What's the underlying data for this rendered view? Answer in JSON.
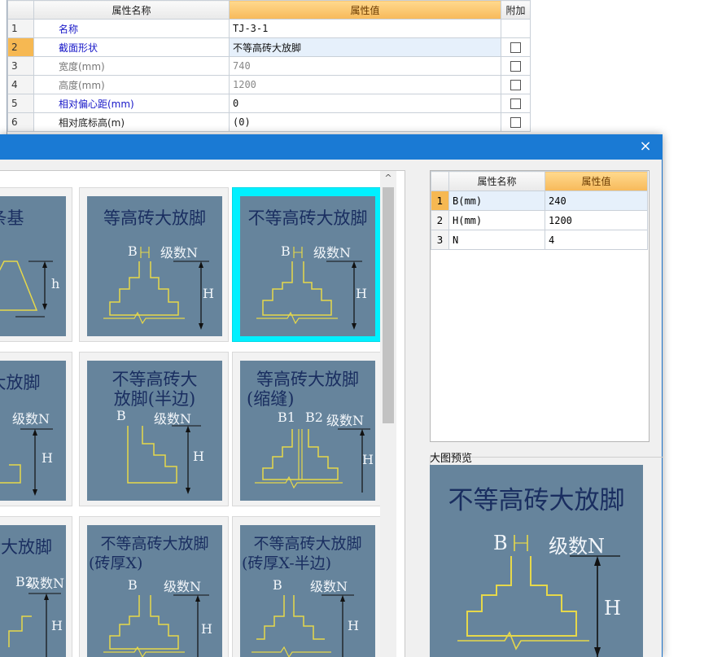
{
  "property_grid": {
    "headers": {
      "index": "",
      "name": "属性名称",
      "value": "属性值",
      "extra": "附加"
    },
    "rows": [
      {
        "num": "1",
        "name": "名称",
        "value": "TJ-3-1",
        "style": "blue",
        "checkbox": false
      },
      {
        "num": "2",
        "name": "截面形状",
        "value": "不等高砖大放脚",
        "style": "blue",
        "checkbox": true
      },
      {
        "num": "3",
        "name": "宽度(mm)",
        "value": "740",
        "style": "gray",
        "checkbox": true
      },
      {
        "num": "4",
        "name": "高度(mm)",
        "value": "1200",
        "style": "gray",
        "checkbox": true
      },
      {
        "num": "5",
        "name": "相对偏心距(mm)",
        "value": "0",
        "style": "blue",
        "checkbox": true
      },
      {
        "num": "6",
        "name": "相对底标高(m)",
        "value": "(0)",
        "style": "black",
        "checkbox": true
      }
    ]
  },
  "dialog": {
    "close_icon": "×",
    "scroll_up_icon": "^",
    "gallery": [
      {
        "caption": [
          "面条基"
        ],
        "labels": [
          "h"
        ]
      },
      {
        "caption": [
          "等高砖大放脚"
        ],
        "labels": [
          "B",
          "级数N",
          "H"
        ]
      },
      {
        "caption": [
          "不等高砖大放脚"
        ],
        "labels": [
          "B",
          "级数N",
          "H"
        ]
      },
      {
        "caption": [
          "大放脚"
        ],
        "labels": [
          "级数N",
          "H"
        ]
      },
      {
        "caption": [
          "不等高砖大",
          "放脚(半边)"
        ],
        "labels": [
          "B",
          "级数N",
          "H"
        ]
      },
      {
        "caption": [
          "等高砖大放脚",
          "(缩缝)"
        ],
        "labels": [
          "B1",
          "B2",
          "级数N",
          "H"
        ]
      },
      {
        "caption": [
          "砖大放脚"
        ],
        "labels": [
          "B2",
          "级数N",
          "H"
        ]
      },
      {
        "caption": [
          "不等高砖大放脚",
          "(砖厚X)"
        ],
        "labels": [
          "B",
          "级数N",
          "H"
        ]
      },
      {
        "caption": [
          "不等高砖大放脚",
          "(砖厚X-半边)"
        ],
        "labels": [
          "B",
          "级数N",
          "H"
        ]
      }
    ],
    "param_grid": {
      "headers": {
        "index": "",
        "name": "属性名称",
        "value": "属性值"
      },
      "rows": [
        {
          "num": "1",
          "name": "B(mm)",
          "value": "240"
        },
        {
          "num": "2",
          "name": "H(mm)",
          "value": "1200"
        },
        {
          "num": "3",
          "name": "N",
          "value": "4"
        }
      ]
    },
    "preview": {
      "label": "大图预览",
      "caption": "不等高砖大放脚",
      "labels": [
        "B",
        "级数N",
        "H"
      ]
    }
  }
}
